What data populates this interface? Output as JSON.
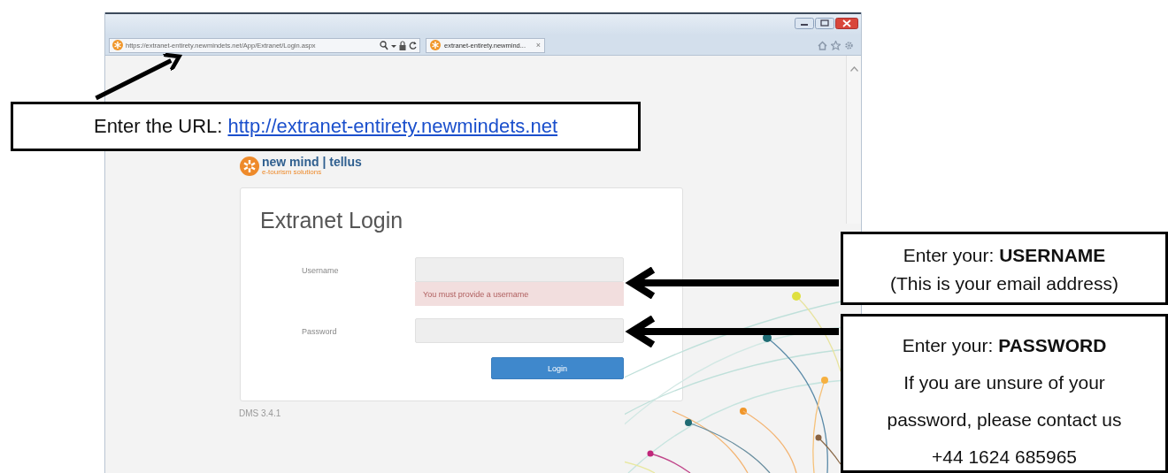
{
  "browser": {
    "address_bar": {
      "url": "https://extranet-entirety.newmindets.net/App/Extranet/Login.aspx"
    },
    "tabs": [
      {
        "title": "extranet-entirety.newmind...",
        "close": "×",
        "selected": true
      }
    ]
  },
  "page": {
    "logo": {
      "name": "new mind | tellus",
      "tagline": "e-tourism solutions"
    },
    "login_card": {
      "heading": "Extranet Login",
      "fields": [
        {
          "label": "Username",
          "error": "You must provide a username"
        },
        {
          "label": "Password"
        }
      ],
      "button": "Login"
    },
    "version": "DMS 3.4.1"
  },
  "annotations": {
    "url_callout": {
      "text": "Enter the URL: ",
      "link": "http://extranet-entirety.newmindets.net"
    },
    "username_callout": {
      "lines": [
        "Enter your: **USERNAME**",
        "(This is your email address)"
      ]
    },
    "password_callout": {
      "lines": [
        "Enter your: **PASSWORD**",
        "If you are unsure of your password, please contact us",
        "+44 1624 685965"
      ]
    }
  }
}
